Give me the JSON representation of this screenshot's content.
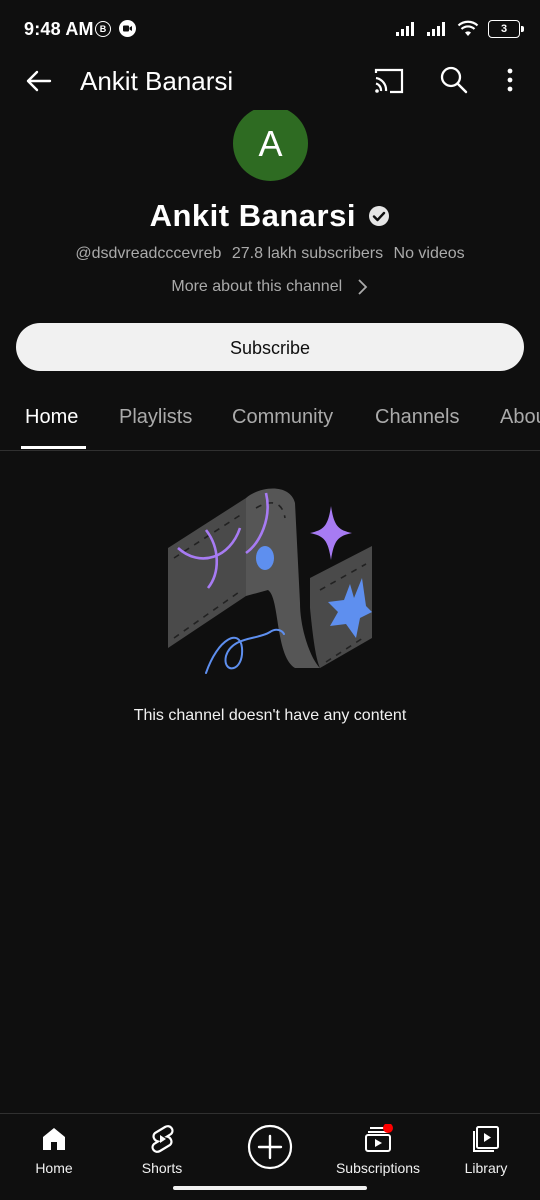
{
  "status_bar": {
    "time": "9:48 AM",
    "b_badge": "B",
    "battery_level": "3"
  },
  "app_bar": {
    "title": "Ankit Banarsi",
    "icons": [
      "back-arrow-icon",
      "cast-icon",
      "search-icon",
      "more-vert-icon"
    ]
  },
  "channel": {
    "avatar_letter": "A",
    "avatar_color": "#2e6b22",
    "name": "Ankit Banarsi",
    "verified": true,
    "handle": "@dsdvreadcccevreb",
    "subscribers": "27.8 lakh subscribers",
    "videos": "No videos",
    "more_about": "More about this channel",
    "subscribe_label": "Subscribe"
  },
  "tabs": [
    {
      "label": "Home",
      "active": true
    },
    {
      "label": "Playlists",
      "active": false
    },
    {
      "label": "Community",
      "active": false
    },
    {
      "label": "Channels",
      "active": false
    },
    {
      "label": "About",
      "active": false
    }
  ],
  "empty_state": {
    "message": "This channel doesn't have any content"
  },
  "bottom_nav": {
    "items": [
      {
        "label": "Home",
        "icon": "home-icon"
      },
      {
        "label": "Shorts",
        "icon": "shorts-icon"
      },
      {
        "label": "",
        "icon": "create-icon"
      },
      {
        "label": "Subscriptions",
        "icon": "subscriptions-icon",
        "notification_dot": true
      },
      {
        "label": "Library",
        "icon": "library-icon"
      }
    ]
  },
  "colors": {
    "background": "#0f0f0f",
    "text_secondary": "#aaaaaa",
    "notification_red": "#ff0000",
    "illustration_purple": "#a77bf3",
    "illustration_blue": "#5e8fef"
  }
}
